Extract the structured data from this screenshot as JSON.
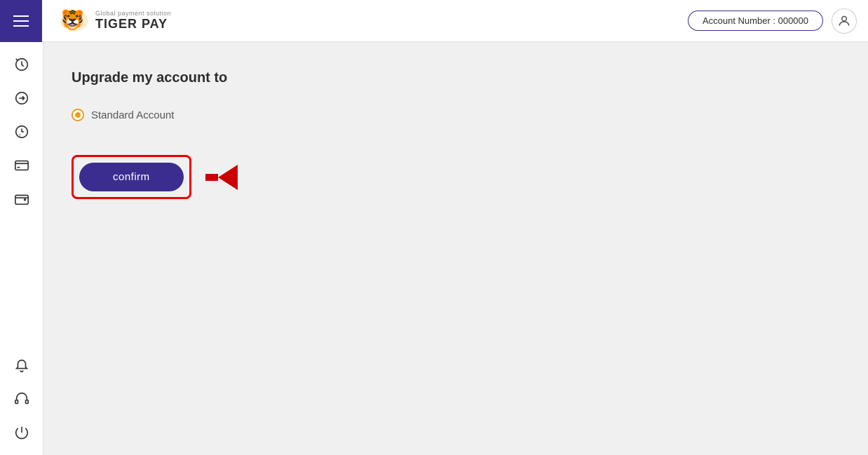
{
  "header": {
    "hamburger_label": "menu",
    "logo_subtitle": "Global payment solution",
    "logo_title": "TIGER PAY",
    "account_label": "Account Number :  000000",
    "user_icon": "person"
  },
  "sidebar": {
    "items": [
      {
        "name": "history-icon",
        "label": "History"
      },
      {
        "name": "transfer-icon",
        "label": "Transfer"
      },
      {
        "name": "time-icon",
        "label": "Schedule"
      },
      {
        "name": "card-icon",
        "label": "Card"
      },
      {
        "name": "wallet-icon",
        "label": "Wallet"
      },
      {
        "name": "notification-icon",
        "label": "Notifications"
      },
      {
        "name": "support-icon",
        "label": "Support"
      },
      {
        "name": "logout-icon",
        "label": "Logout"
      }
    ]
  },
  "main": {
    "page_title": "Upgrade my account to",
    "radio_option_label": "Standard Account",
    "confirm_button_label": "confirm"
  }
}
